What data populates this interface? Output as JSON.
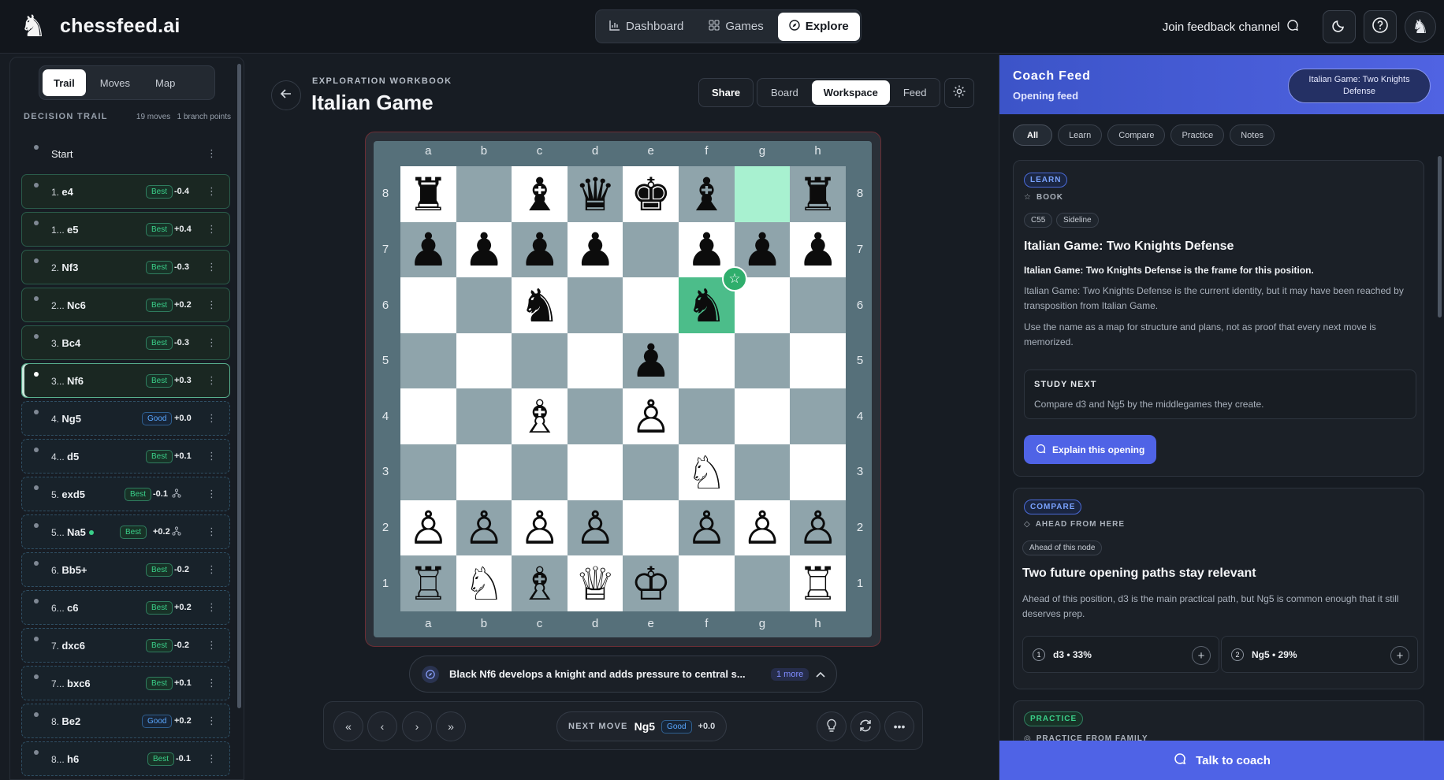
{
  "app": {
    "name": "chessfeed.ai",
    "logo_icon": "knight-logo-icon"
  },
  "nav": {
    "items": [
      {
        "label": "Dashboard",
        "icon": "chart-icon",
        "active": false
      },
      {
        "label": "Games",
        "icon": "grid-icon",
        "active": false
      },
      {
        "label": "Explore",
        "icon": "compass-icon",
        "active": true
      }
    ]
  },
  "header": {
    "feedback_label": "Join feedback channel"
  },
  "sidebar": {
    "tabs": [
      "Trail",
      "Moves",
      "Map"
    ],
    "active_tab": "Trail",
    "trail_title": "DECISION TRAIL",
    "moves_count": "19 moves",
    "branch_points": "1 branch points",
    "start_label": "Start",
    "moves": [
      {
        "num": "1.",
        "san": "e4",
        "quality": "Best",
        "eval": "-0.4"
      },
      {
        "num": "1...",
        "san": "e5",
        "quality": "Best",
        "eval": "+0.4"
      },
      {
        "num": "2.",
        "san": "Nf3",
        "quality": "Best",
        "eval": "-0.3"
      },
      {
        "num": "2...",
        "san": "Nc6",
        "quality": "Best",
        "eval": "+0.2"
      },
      {
        "num": "3.",
        "san": "Bc4",
        "quality": "Best",
        "eval": "-0.3"
      },
      {
        "num": "3...",
        "san": "Nf6",
        "quality": "Best",
        "eval": "+0.3"
      },
      {
        "num": "4.",
        "san": "Ng5",
        "quality": "Good",
        "eval": "+0.0"
      },
      {
        "num": "4...",
        "san": "d5",
        "quality": "Best",
        "eval": "+0.1"
      },
      {
        "num": "5.",
        "san": "exd5",
        "quality": "Best",
        "eval": "-0.1"
      },
      {
        "num": "5...",
        "san": "Na5",
        "quality": "Best",
        "eval": "+0.2"
      },
      {
        "num": "6.",
        "san": "Bb5+",
        "quality": "Best",
        "eval": "-0.2"
      },
      {
        "num": "6...",
        "san": "c6",
        "quality": "Best",
        "eval": "+0.2"
      },
      {
        "num": "7.",
        "san": "dxc6",
        "quality": "Best",
        "eval": "-0.2"
      },
      {
        "num": "7...",
        "san": "bxc6",
        "quality": "Best",
        "eval": "+0.1"
      },
      {
        "num": "8.",
        "san": "Be2",
        "quality": "Good",
        "eval": "+0.2"
      },
      {
        "num": "8...",
        "san": "h6",
        "quality": "Best",
        "eval": "-0.1"
      }
    ]
  },
  "workbook": {
    "label": "EXPLORATION WORKBOOK",
    "title": "Italian Game",
    "share_label": "Share",
    "views": [
      "Board",
      "Workspace",
      "Feed"
    ],
    "active_view": "Workspace"
  },
  "board": {
    "files": [
      "a",
      "b",
      "c",
      "d",
      "e",
      "f",
      "g",
      "h"
    ],
    "ranks": [
      "8",
      "7",
      "6",
      "5",
      "4",
      "3",
      "2",
      "1"
    ],
    "pieces": {
      "a8": "bR",
      "c8": "bB",
      "d8": "bQ",
      "e8": "bK",
      "f8": "bB",
      "h8": "bR",
      "a7": "bP",
      "b7": "bP",
      "c7": "bP",
      "d7": "bP",
      "f7": "bP",
      "g7": "bP",
      "h7": "bP",
      "c6": "bN",
      "f6": "bN",
      "e5": "bP",
      "c4": "wB",
      "e4": "wP",
      "f3": "wN",
      "a2": "wP",
      "b2": "wP",
      "c2": "wP",
      "d2": "wP",
      "f2": "wP",
      "g2": "wP",
      "h2": "wP",
      "a1": "wR",
      "b1": "wN",
      "c1": "wB",
      "d1": "wQ",
      "e1": "wK",
      "h1": "wR"
    },
    "highlight": [
      "g8",
      "f6"
    ],
    "best_marker": "star-icon"
  },
  "insight": {
    "text": "Black Nf6 develops a knight and adds pressure to central s...",
    "more": "1 more"
  },
  "controls": {
    "next_move_label": "NEXT MOVE",
    "next_move": "Ng5",
    "next_quality": "Good",
    "next_eval": "+0.0"
  },
  "coach": {
    "title": "Coach Feed",
    "subtitle": "Opening feed",
    "opening_pill": "Italian Game: Two Knights Defense",
    "filters": [
      "All",
      "Learn",
      "Compare",
      "Practice",
      "Notes"
    ],
    "active_filter": "All",
    "learn_card": {
      "tag": "LEARN",
      "kicker": "BOOK",
      "chips": [
        "C55",
        "Sideline"
      ],
      "title": "Italian Game: Two Knights Defense",
      "lead": "Italian Game: Two Knights Defense is the frame for this position.",
      "p1": "Italian Game: Two Knights Defense is the current identity, but it may have been reached by transposition from Italian Game.",
      "p2": "Use the name as a map for structure and plans, not as proof that every next move is memorized.",
      "study_title": "STUDY NEXT",
      "study_text": "Compare d3 and Ng5 by the middlegames they create.",
      "button": "Explain this opening"
    },
    "compare_card": {
      "tag": "COMPARE",
      "kicker": "AHEAD FROM HERE",
      "chip": "Ahead of this node",
      "title": "Two future opening paths stay relevant",
      "p": "Ahead of this position, d3 is the main practical path, but Ng5 is common enough that it still deserves prep.",
      "paths": [
        {
          "n": "1",
          "text": "d3 • 33%"
        },
        {
          "n": "2",
          "text": "Ng5 • 29%"
        }
      ]
    },
    "practice_card": {
      "tag": "PRACTICE",
      "kicker": "PRACTICE FROM FAMILY"
    },
    "talk_button": "Talk to coach"
  }
}
